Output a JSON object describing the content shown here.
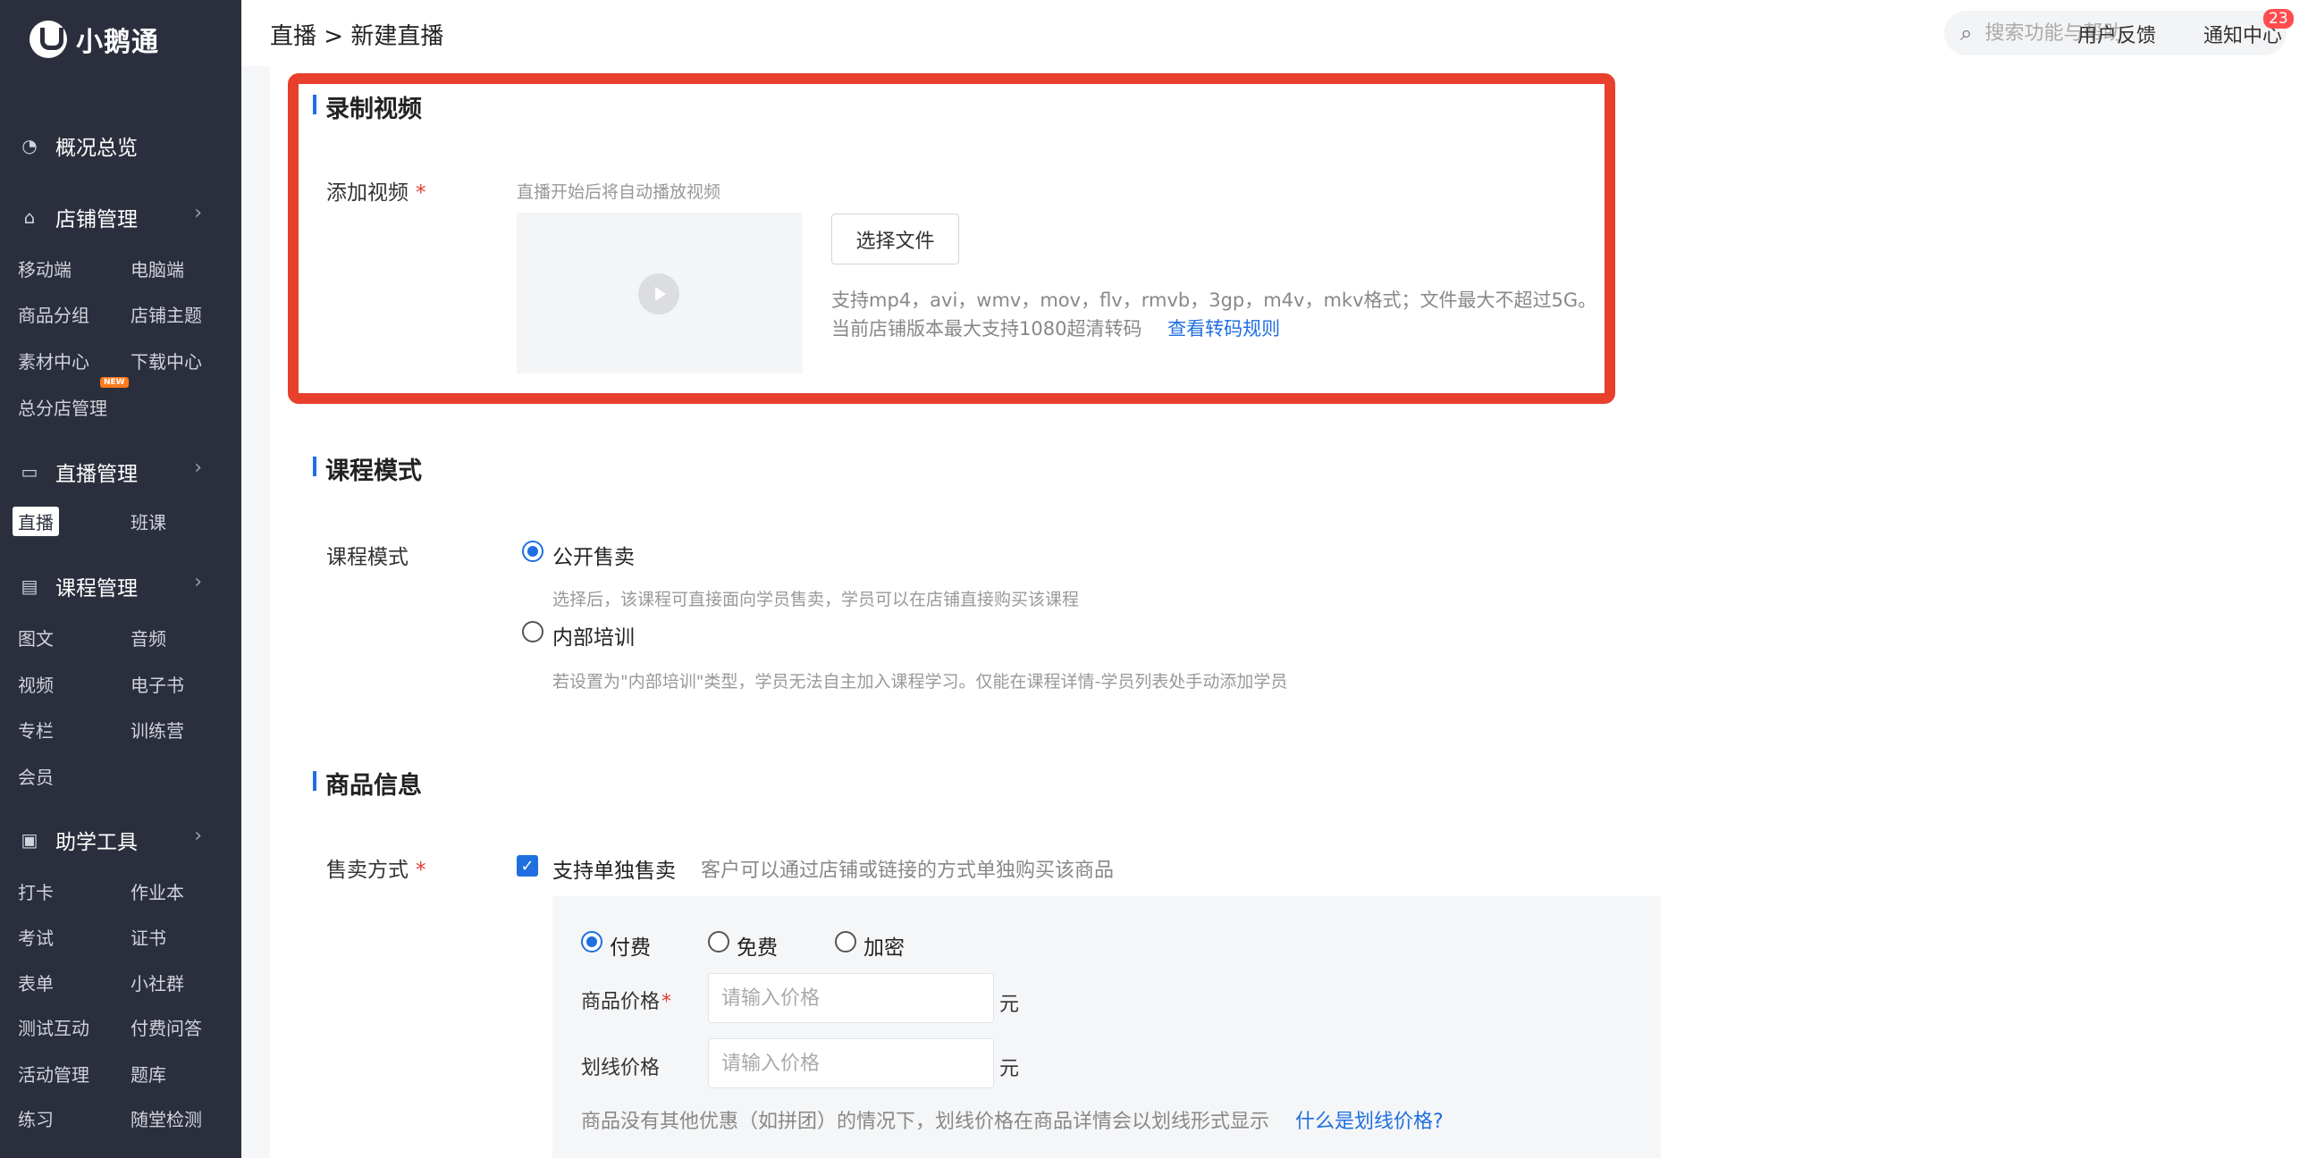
{
  "app": {
    "logo_text": "小鹅通"
  },
  "sidebar": {
    "overview": "概况总览",
    "store": {
      "label": "店铺管理",
      "items": [
        "移动端",
        "电脑端",
        "商品分组",
        "店铺主题",
        "素材中心",
        "下载中心",
        "总分店管理"
      ],
      "new_badge": "NEW"
    },
    "live": {
      "label": "直播管理",
      "items": [
        "直播",
        "班课"
      ]
    },
    "course": {
      "label": "课程管理",
      "items": [
        "图文",
        "音频",
        "视频",
        "电子书",
        "专栏",
        "训练营",
        "会员"
      ]
    },
    "tools": {
      "label": "助学工具",
      "items": [
        "打卡",
        "作业本",
        "考试",
        "证书",
        "表单",
        "小社群",
        "测试互动",
        "付费问答",
        "活动管理",
        "题库",
        "练习",
        "随堂检测"
      ]
    }
  },
  "header": {
    "breadcrumb": "直播 > 新建直播",
    "search_placeholder": "搜索功能与帮助",
    "feedback": "用户反馈",
    "notifications": "通知中心",
    "notification_count": "23"
  },
  "record": {
    "title": "录制视频",
    "add_label": "添加视频",
    "hint": "直播开始后将自动播放视频",
    "choose_button": "选择文件",
    "format_note": "支持mp4，avi，wmv，mov，flv，rmvb，3gp，m4v，mkv格式；文件最大不超过5G。",
    "transcode_note": "当前店铺版本最大支持1080超清转码",
    "transcode_link": "查看转码规则"
  },
  "course_mode": {
    "title": "课程模式",
    "label": "课程模式",
    "options": [
      {
        "label": "公开售卖",
        "desc": "选择后，该课程可直接面向学员售卖，学员可以在店铺直接购买该课程",
        "checked": true
      },
      {
        "label": "内部培训",
        "desc": "若设置为\"内部培训\"类型，学员无法自主加入课程学习。仅能在课程详情-学员列表处手动添加学员",
        "checked": false
      }
    ]
  },
  "goods": {
    "title": "商品信息",
    "sale_label": "售卖方式",
    "single_sale": "支持单独售卖",
    "single_sale_desc": "客户可以通过店铺或链接的方式单独购买该商品",
    "price_types": [
      "付费",
      "免费",
      "加密"
    ],
    "price_label": "商品价格",
    "price_placeholder": "请输入价格",
    "strike_label": "划线价格",
    "strike_placeholder": "请输入价格",
    "unit": "元",
    "strike_note": "商品没有其他优惠（如拼团）的情况下，划线价格在商品详情会以划线形式显示",
    "strike_link": "什么是划线价格?"
  },
  "colors": {
    "accent": "#1f6fe0",
    "highlight": "#e8402c",
    "sidebar": "#2b2f3d"
  }
}
